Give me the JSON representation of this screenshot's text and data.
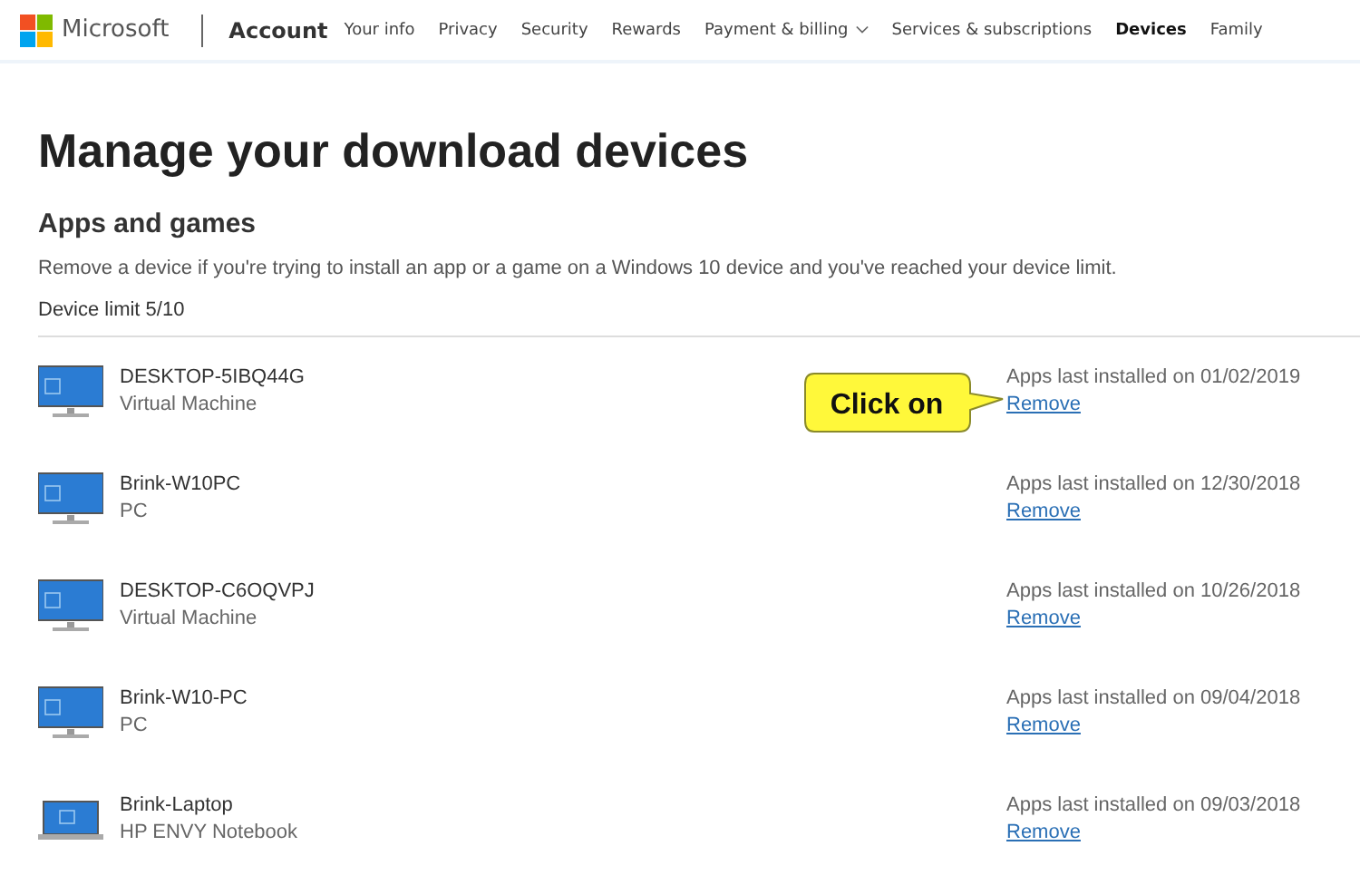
{
  "header": {
    "brand": "Microsoft",
    "section": "Account",
    "nav": [
      {
        "label": "Your info",
        "selected": false,
        "dropdown": false
      },
      {
        "label": "Privacy",
        "selected": false,
        "dropdown": false
      },
      {
        "label": "Security",
        "selected": false,
        "dropdown": false
      },
      {
        "label": "Rewards",
        "selected": false,
        "dropdown": false
      },
      {
        "label": "Payment & billing",
        "selected": false,
        "dropdown": true
      },
      {
        "label": "Services & subscriptions",
        "selected": false,
        "dropdown": false
      },
      {
        "label": "Devices",
        "selected": true,
        "dropdown": false
      },
      {
        "label": "Family",
        "selected": false,
        "dropdown": false
      }
    ]
  },
  "page_title": "Manage your download devices",
  "section_title": "Apps and games",
  "description": "Remove a device if you're trying to install an app or a game on a Windows 10 device and you've reached your device limit.",
  "device_limit": "Device limit 5/10",
  "devices": [
    {
      "kind": "desktop",
      "name": "DESKTOP-5IBQ44G",
      "type": "Virtual Machine",
      "installed": "Apps last installed on 01/02/2019",
      "action": "Remove",
      "callout": "Click on"
    },
    {
      "kind": "desktop",
      "name": "Brink-W10PC",
      "type": "PC",
      "installed": "Apps last installed on 12/30/2018",
      "action": "Remove"
    },
    {
      "kind": "desktop",
      "name": "DESKTOP-C6OQVPJ",
      "type": "Virtual Machine",
      "installed": "Apps last installed on 10/26/2018",
      "action": "Remove"
    },
    {
      "kind": "desktop",
      "name": "Brink-W10-PC",
      "type": "PC",
      "installed": "Apps last installed on 09/04/2018",
      "action": "Remove"
    },
    {
      "kind": "laptop",
      "name": "Brink-Laptop",
      "type": "HP ENVY Notebook",
      "installed": "Apps last installed on 09/03/2018",
      "action": "Remove"
    }
  ]
}
